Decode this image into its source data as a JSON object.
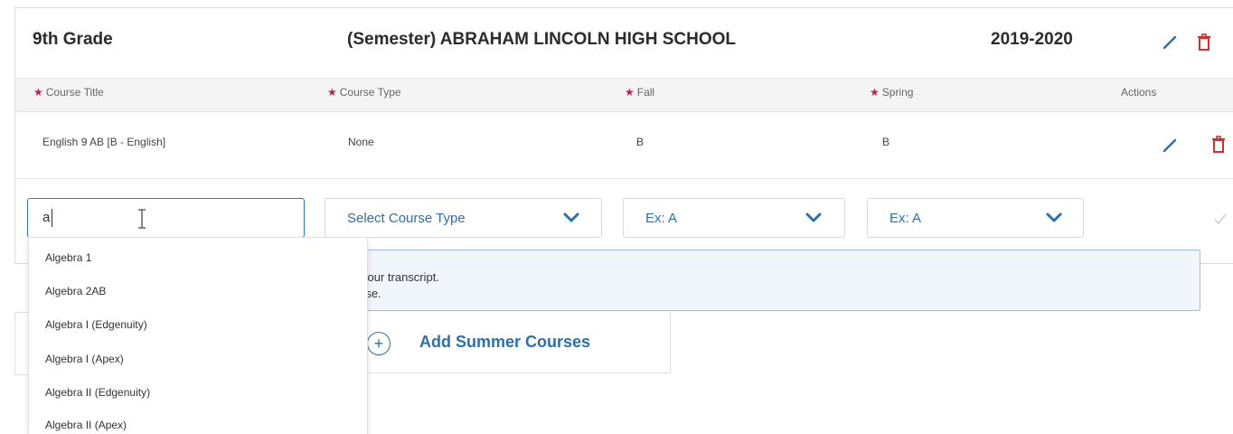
{
  "section": {
    "grade": "9th Grade",
    "school": "(Semester) ABRAHAM LINCOLN HIGH SCHOOL",
    "year": "2019-2020"
  },
  "columns": {
    "course_title": "Course Title",
    "course_type": "Course Type",
    "fall": "Fall",
    "spring": "Spring",
    "actions": "Actions"
  },
  "row": {
    "course_title": "English 9 AB [B - English]",
    "course_type": "None",
    "fall": "B",
    "spring": "B"
  },
  "new_row": {
    "course_title_value": "a",
    "course_type_placeholder": "Select Course Type",
    "fall_placeholder": "Ex: A",
    "spring_placeholder": "Ex: A"
  },
  "suggestions": [
    "Algebra 1",
    "Algebra 2AB",
    "Algebra I (Edgenuity)",
    "Algebra I (Apex)",
    "Algebra II (Edgenuity)",
    "Algebra II (Apex)"
  ],
  "info": {
    "line1": "your transcript.",
    "line2": "rse."
  },
  "summer": {
    "label": "Add Summer Courses"
  },
  "colors": {
    "accent": "#2a6fb0",
    "delete": "#d32f2f",
    "required_star": "#c2185b"
  },
  "icons": {
    "edit": "pencil-icon",
    "delete": "trash-icon",
    "dropdown": "chevron-down-icon",
    "add": "plus-circle-icon",
    "confirm": "check-icon",
    "cursor": "text-cursor-icon"
  }
}
